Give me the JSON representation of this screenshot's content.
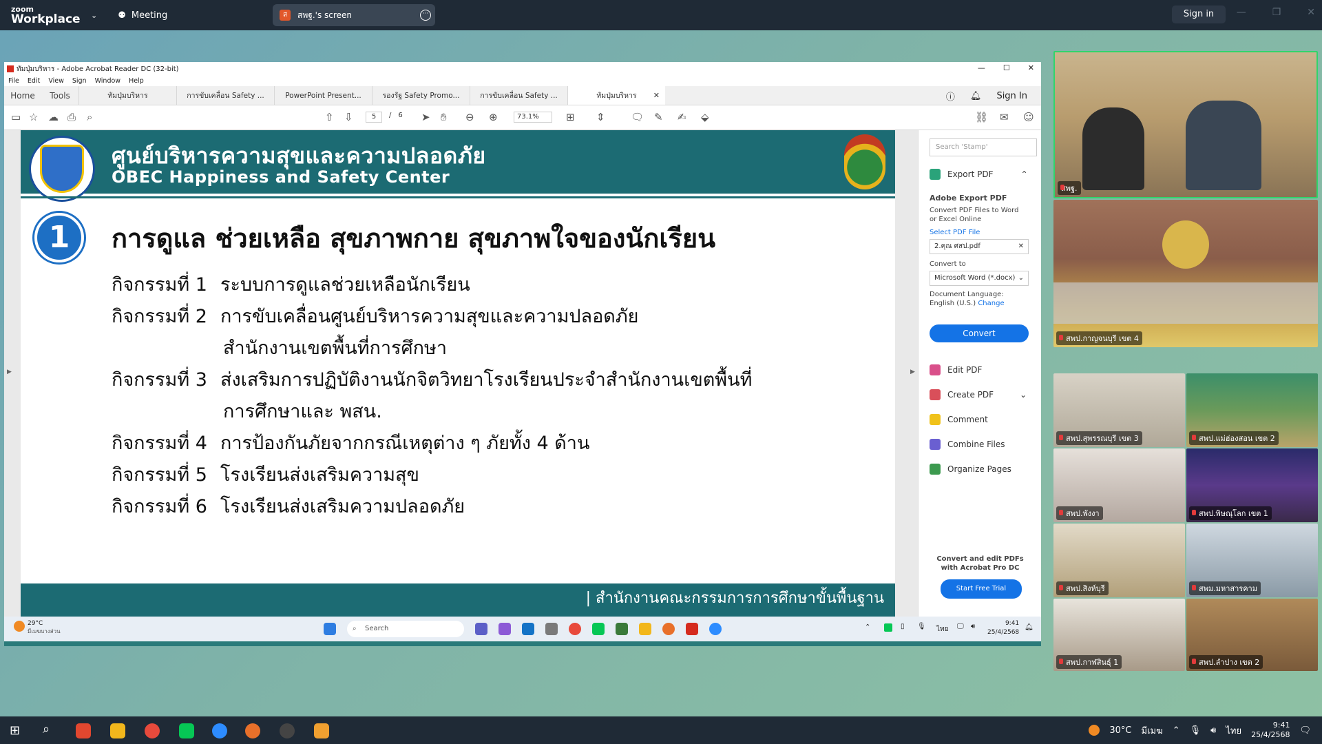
{
  "zoom": {
    "brand_line1": "zoom",
    "brand_line2": "Workplace",
    "meeting_label": "Meeting",
    "share_label": "สพฐ.'s screen",
    "share_badge": "ส",
    "signin_label": "Sign in"
  },
  "acrobat": {
    "title": "ทัมปุ่มบริหาร - Adobe Acrobat Reader DC (32-bit)",
    "menu": [
      "File",
      "Edit",
      "View",
      "Sign",
      "Window",
      "Help"
    ],
    "home_label": "Home",
    "tools_label": "Tools",
    "tabs": [
      "ทัมปุ่มบริหาร",
      "การขับเคลื่อน  Safety ...",
      "PowerPoint Present...",
      "รองรัฐ Safety Promo...",
      "การขับเคลื่อน  Safety ...",
      "ทัมปุ่มบริหาร"
    ],
    "signin_label": "Sign In",
    "page_current": "5",
    "page_sep": "/",
    "page_total": "6",
    "zoom_value": "73.1%"
  },
  "slide": {
    "header_th": "ศูนย์บริหารความสุขและความปลอดภัย",
    "header_en": "OBEC Happiness and Safety Center",
    "number": "1",
    "title": "การดูแล ช่วยเหลือ สุขภาพกาย สุขภาพใจของนักเรียน",
    "activities": [
      {
        "label": "กิจกรรมที่ 1",
        "text": "ระบบการดูแลช่วยเหลือนักเรียน",
        "cont": ""
      },
      {
        "label": "กิจกรรมที่ 2",
        "text": "การขับเคลื่อนศูนย์บริหารความสุขและความปลอดภัย",
        "cont": "สำนักงานเขตพื้นที่การศึกษา"
      },
      {
        "label": "กิจกรรมที่ 3",
        "text": "ส่งเสริมการปฏิบัติงานนักจิตวิทยาโรงเรียนประจำสำนักงานเขตพื้นที่",
        "cont": "การศึกษาและ พสน."
      },
      {
        "label": "กิจกรรมที่ 4",
        "text": "การป้องกันภัยจากกรณีเหตุต่าง ๆ ภัยทั้ง 4 ด้าน",
        "cont": ""
      },
      {
        "label": "กิจกรรมที่ 5",
        "text": "โรงเรียนส่งเสริมความสุข",
        "cont": ""
      },
      {
        "label": "กิจกรรมที่ 6",
        "text": "โรงเรียนส่งเสริมความปลอดภัย",
        "cont": ""
      }
    ],
    "footer": "| สำนักงานคณะกรรมการการศึกษาขั้นพื้นฐาน"
  },
  "panel": {
    "search_placeholder": "Search 'Stamp'",
    "export_pdf": "Export PDF",
    "adobe_export_title": "Adobe Export PDF",
    "adobe_export_desc1": "Convert PDF Files to Word",
    "adobe_export_desc2": "or Excel Online",
    "select_file_label": "Select PDF File",
    "file_name": "2.คุณ ศสป.pdf",
    "convert_to_label": "Convert to",
    "convert_to_value": "Microsoft Word (*.docx)",
    "doc_lang_label": "Document Language:",
    "doc_lang_value": "English (U.S.)",
    "change_link": "Change",
    "convert_button": "Convert",
    "tools": [
      "Edit PDF",
      "Create PDF",
      "Comment",
      "Combine Files",
      "Organize Pages"
    ],
    "promo_line1": "Convert and edit PDFs",
    "promo_line2": "with Acrobat Pro DC",
    "trial_button": "Start Free Trial"
  },
  "remote_taskbar": {
    "weather_temp": "29°C",
    "weather_desc": "มีเมฆบางส่วน",
    "search_label": "Search",
    "lang": "ไทย",
    "time": "9:41",
    "date": "25/4/2568"
  },
  "gallery": {
    "speaker_top": "สพฐ.",
    "speaker_second": "สพป.กาญจนบุรี เขต 4",
    "tiles": [
      "สพป.สุพรรณบุรี เขต 3",
      "สพป.แม่ฮ่องสอน เขต 2",
      "สพป.พังงา",
      "สพป.พิษณุโลก เขต 1",
      "สพป.สิงห์บุรี",
      "สพม.มหาสารคาม",
      "สพป.กาฬสินธุ์ 1",
      "สพป.ลำปาง เขต 2"
    ]
  },
  "local_taskbar": {
    "weather_temp": "30°C",
    "weather_desc": "มีเมฆ",
    "lang": "ไทย",
    "time": "9:41",
    "date": "25/4/2568"
  }
}
